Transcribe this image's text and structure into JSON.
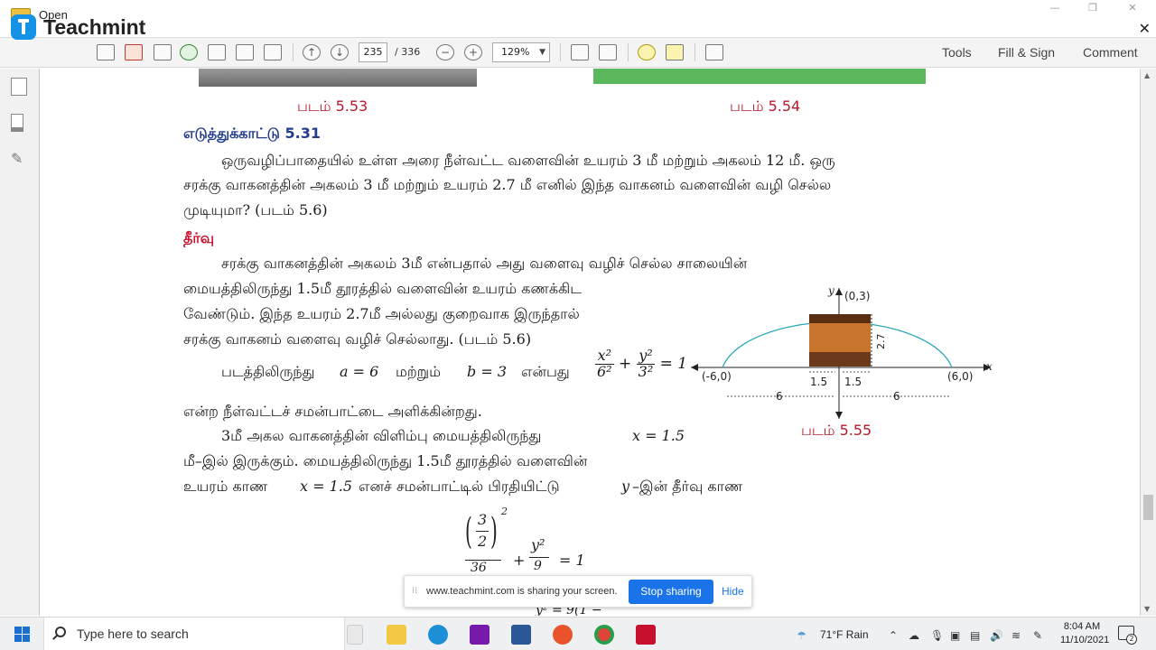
{
  "window": {
    "title": "",
    "brand": "Teachmint"
  },
  "toolbar": {
    "open_label": "Open",
    "page_current": "235",
    "page_total": "/ 336",
    "zoom": "129%",
    "tools_label": "Tools",
    "fill_sign_label": "Fill & Sign",
    "comment_label": "Comment"
  },
  "document": {
    "fig_553": "படம் 5.53",
    "fig_554": "படம் 5.54",
    "example_heading": "எடுத்துக்காட்டு 5.31",
    "problem": [
      "ஒருவழிப்பாதையில் உள்ள அரை நீள்வட்ட வளைவின் உயரம் 3 மீ மற்றும்  அகலம் 12 மீ. ஒரு",
      "சரக்கு வாகனத்தின் அகலம் 3 மீ மற்றும் உயரம் 2.7 மீ எனில் இந்த வாகனம் வளைவின் வழி செல்ல",
      "முடியுமா? (படம் 5.6)"
    ],
    "solution_heading": "தீர்வு",
    "solution_para1": [
      "சரக்கு  வாகனத்தின்  அகலம்  3மீ  என்பதால்  அது  வளைவு  வழிச்  செல்ல  சாலையின்",
      "மையத்திலிருந்து 1.5மீ தூரத்தில் வளைவின் உயரம் கணக்கிட",
      "வேண்டும். இந்த உயரம் 2.7மீ அல்லது குறைவாக இருந்தால்",
      "சரக்கு வாகனம் வளைவு வழிச் செல்லாது. (படம் 5.6)"
    ],
    "from_fig_prefix": "படத்திலிருந்து",
    "a_equals": "a = 6",
    "and_word": "மற்றும்",
    "b_equals": "b = 3",
    "which_is": "என்பது",
    "eq_x_num": "x²",
    "eq_x_den": "6²",
    "eq_y_num": "y²",
    "eq_y_den": "3²",
    "eq_plus": "+",
    "eq_equals_one": "= 1",
    "ellipse_line": "என்ற நீள்வட்டச் சமன்பாட்டை அளிக்கின்றது.",
    "para2": [
      "3மீ அகல வாகனத்தின் விளிம்பு மையத்திலிருந்து",
      "மீ–இல் இருக்கும். மையத்திலிருந்து 1.5மீ தூரத்தில் வளைவின்",
      "உயரம் காண"
    ],
    "x_eq_15": "x = 1.5",
    "x_eq_15b": "x = 1.5",
    "substitute_text": "எனச் சமன்பாட்டில் பிரதியிட்டு",
    "y_var": "y",
    "solve_text": "–இன் தீர்வு காண",
    "eq2_frac_num": "3",
    "eq2_frac_den": "2",
    "eq2_sq": "2",
    "eq2_y_num": "y²",
    "eq2_plus": "+",
    "eq2_eq": "= 1",
    "eq2_36": "36",
    "eq2_9": "9",
    "eq3_partial": "y² = 9(1 −"
  },
  "figure": {
    "caption": "படம் 5.55",
    "x_axis": "x",
    "y_axis": "y",
    "vertex_label": "(0,3)",
    "left_label": "(-6,0)",
    "right_label": "(6,0)",
    "height_label": "2.7",
    "half_left": "1.5",
    "half_right": "1.5",
    "dist_left": "6",
    "dist_right": "6",
    "colors": {
      "arc": "#2aa7b8",
      "truck": "#c8742c",
      "truck_dark": "#5a2e12"
    }
  },
  "share_banner": {
    "text": "www.teachmint.com is sharing your screen.",
    "stop_label": "Stop sharing",
    "hide_label": "Hide"
  },
  "taskbar": {
    "search_placeholder": "Type here to search",
    "weather": "71°F  Rain",
    "time": "8:04 AM",
    "date": "11/10/2021",
    "notifications": "2"
  }
}
